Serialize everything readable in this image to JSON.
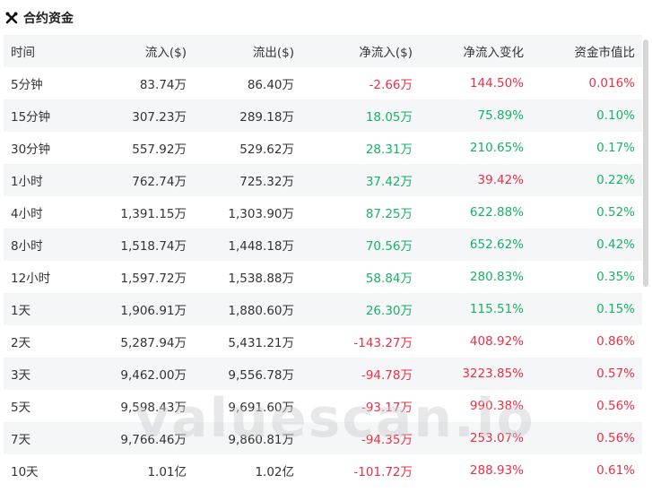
{
  "title": "合约资金",
  "icon": "crossed-tools-icon",
  "colors": {
    "positive": "#16b364",
    "negative": "#ee2e45",
    "stripe": "#f5f6f8"
  },
  "columns": [
    "时间",
    "流入($)",
    "流出($)",
    "净流入($)",
    "净流入变化",
    "资金市值比"
  ],
  "rows": [
    {
      "period": "5分钟",
      "inflow": "83.74万",
      "outflow": "86.40万",
      "net": "-2.66万",
      "net_dir": "neg",
      "change": "144.50%",
      "change_dir": "neg",
      "ratio": "0.016%",
      "ratio_dir": "neg"
    },
    {
      "period": "15分钟",
      "inflow": "307.23万",
      "outflow": "289.18万",
      "net": "18.05万",
      "net_dir": "pos",
      "change": "75.89%",
      "change_dir": "pos",
      "ratio": "0.10%",
      "ratio_dir": "pos"
    },
    {
      "period": "30分钟",
      "inflow": "557.92万",
      "outflow": "529.62万",
      "net": "28.31万",
      "net_dir": "pos",
      "change": "210.65%",
      "change_dir": "pos",
      "ratio": "0.17%",
      "ratio_dir": "pos"
    },
    {
      "period": "1小时",
      "inflow": "762.74万",
      "outflow": "725.32万",
      "net": "37.42万",
      "net_dir": "pos",
      "change": "39.42%",
      "change_dir": "neg",
      "ratio": "0.22%",
      "ratio_dir": "pos"
    },
    {
      "period": "4小时",
      "inflow": "1,391.15万",
      "outflow": "1,303.90万",
      "net": "87.25万",
      "net_dir": "pos",
      "change": "622.88%",
      "change_dir": "pos",
      "ratio": "0.52%",
      "ratio_dir": "pos"
    },
    {
      "period": "8小时",
      "inflow": "1,518.74万",
      "outflow": "1,448.18万",
      "net": "70.56万",
      "net_dir": "pos",
      "change": "652.62%",
      "change_dir": "pos",
      "ratio": "0.42%",
      "ratio_dir": "pos"
    },
    {
      "period": "12小时",
      "inflow": "1,597.72万",
      "outflow": "1,538.88万",
      "net": "58.84万",
      "net_dir": "pos",
      "change": "280.83%",
      "change_dir": "pos",
      "ratio": "0.35%",
      "ratio_dir": "pos"
    },
    {
      "period": "1天",
      "inflow": "1,906.91万",
      "outflow": "1,880.60万",
      "net": "26.30万",
      "net_dir": "pos",
      "change": "115.51%",
      "change_dir": "pos",
      "ratio": "0.15%",
      "ratio_dir": "pos"
    },
    {
      "period": "2天",
      "inflow": "5,287.94万",
      "outflow": "5,431.21万",
      "net": "-143.27万",
      "net_dir": "neg",
      "change": "408.92%",
      "change_dir": "neg",
      "ratio": "0.86%",
      "ratio_dir": "neg"
    },
    {
      "period": "3天",
      "inflow": "9,462.00万",
      "outflow": "9,556.78万",
      "net": "-94.78万",
      "net_dir": "neg",
      "change": "3223.85%",
      "change_dir": "neg",
      "ratio": "0.57%",
      "ratio_dir": "neg"
    },
    {
      "period": "5天",
      "inflow": "9,598.43万",
      "outflow": "9,691.60万",
      "net": "-93.17万",
      "net_dir": "neg",
      "change": "990.38%",
      "change_dir": "neg",
      "ratio": "0.56%",
      "ratio_dir": "neg"
    },
    {
      "period": "7天",
      "inflow": "9,766.46万",
      "outflow": "9,860.81万",
      "net": "-94.35万",
      "net_dir": "neg",
      "change": "253.07%",
      "change_dir": "neg",
      "ratio": "0.56%",
      "ratio_dir": "neg"
    },
    {
      "period": "10天",
      "inflow": "1.01亿",
      "outflow": "1.02亿",
      "net": "-101.72万",
      "net_dir": "neg",
      "change": "288.93%",
      "change_dir": "neg",
      "ratio": "0.61%",
      "ratio_dir": "neg"
    }
  ],
  "watermark": "valuescan.io"
}
